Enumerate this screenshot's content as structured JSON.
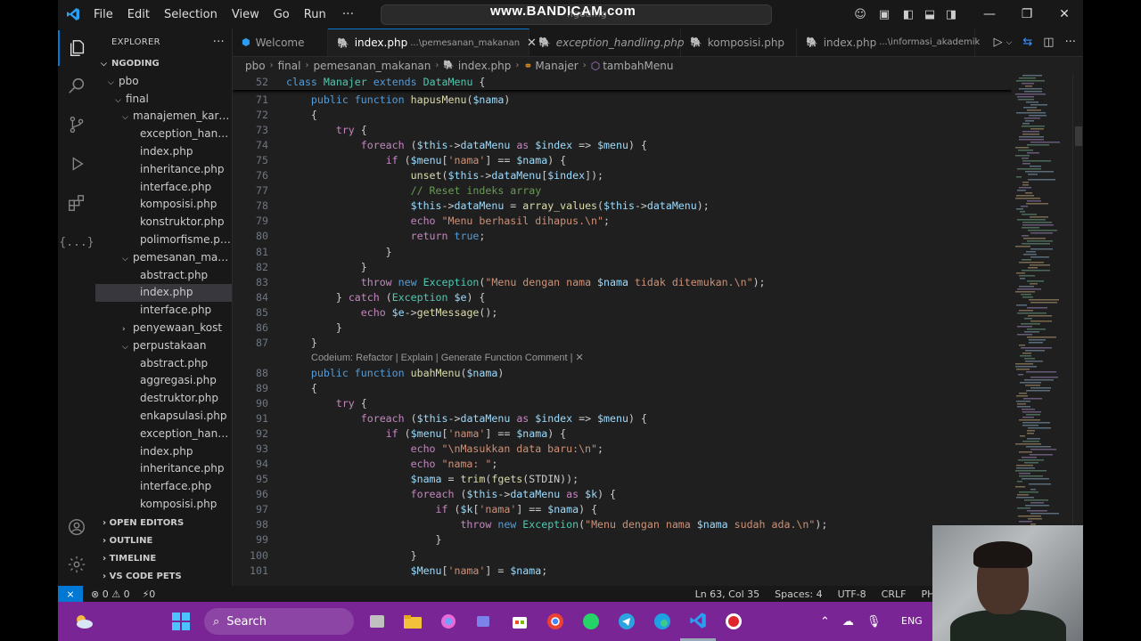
{
  "titlebar": {
    "menu": [
      "File",
      "Edit",
      "Selection",
      "View",
      "Go",
      "Run"
    ],
    "more": "···",
    "watermark": "www.BANDICAM.com",
    "search_text": "ngoding"
  },
  "sidebar": {
    "title": "EXPLORER",
    "more": "···",
    "tree": [
      {
        "label": "NGODING",
        "depth": 0,
        "chev": "⌵",
        "bold": true
      },
      {
        "label": "pbo",
        "depth": 1,
        "chev": "⌵"
      },
      {
        "label": "final",
        "depth": 2,
        "chev": "⌵"
      },
      {
        "label": "manajemen_karya...",
        "depth": 3,
        "chev": "⌵"
      },
      {
        "label": "exception_handli...",
        "depth": 4,
        "chev": ""
      },
      {
        "label": "index.php",
        "depth": 4,
        "chev": ""
      },
      {
        "label": "inheritance.php",
        "depth": 4,
        "chev": ""
      },
      {
        "label": "interface.php",
        "depth": 4,
        "chev": ""
      },
      {
        "label": "komposisi.php",
        "depth": 4,
        "chev": ""
      },
      {
        "label": "konstruktor.php",
        "depth": 4,
        "chev": ""
      },
      {
        "label": "polimorfisme.php",
        "depth": 4,
        "chev": ""
      },
      {
        "label": "pemesanan_maka...",
        "depth": 3,
        "chev": "⌵"
      },
      {
        "label": "abstract.php",
        "depth": 4,
        "chev": ""
      },
      {
        "label": "index.php",
        "depth": 4,
        "chev": "",
        "selected": true
      },
      {
        "label": "interface.php",
        "depth": 4,
        "chev": ""
      },
      {
        "label": "penyewaan_kost",
        "depth": 3,
        "chev": "›"
      },
      {
        "label": "perpustakaan",
        "depth": 3,
        "chev": "⌵"
      },
      {
        "label": "abstract.php",
        "depth": 4,
        "chev": ""
      },
      {
        "label": "aggregasi.php",
        "depth": 4,
        "chev": ""
      },
      {
        "label": "destruktor.php",
        "depth": 4,
        "chev": ""
      },
      {
        "label": "enkapsulasi.php",
        "depth": 4,
        "chev": ""
      },
      {
        "label": "exception_handli...",
        "depth": 4,
        "chev": ""
      },
      {
        "label": "index.php",
        "depth": 4,
        "chev": ""
      },
      {
        "label": "inheritance.php",
        "depth": 4,
        "chev": ""
      },
      {
        "label": "interface.php",
        "depth": 4,
        "chev": ""
      },
      {
        "label": "komposisi.php",
        "depth": 4,
        "chev": ""
      }
    ],
    "sections": [
      "OPEN EDITORS",
      "OUTLINE",
      "TIMELINE",
      "VS CODE PETS"
    ]
  },
  "tabs": [
    {
      "label": "Welcome",
      "desc": "",
      "icon": "vscode-icon",
      "active": false,
      "italic": false
    },
    {
      "label": "index.php",
      "desc": "...\\pemesanan_makanan",
      "icon": "php-icon",
      "active": true,
      "italic": false
    },
    {
      "label": "exception_handling.php",
      "desc": "",
      "icon": "php-icon",
      "active": false,
      "italic": true
    },
    {
      "label": "komposisi.php",
      "desc": "",
      "icon": "php-icon",
      "active": false,
      "italic": false
    },
    {
      "label": "index.php",
      "desc": "...\\informasi_akademik",
      "icon": "php-icon",
      "active": false,
      "italic": false
    }
  ],
  "breadcrumb": [
    "pbo",
    "final",
    "pemesanan_makanan",
    "index.php",
    "Manajer",
    "tambahMenu"
  ],
  "editor": {
    "sticky": {
      "ln": "52",
      "html": "<span class='kw'>class</span> <span class='cls'>Manajer</span> <span class='kw'>extends</span> <span class='cls'>DataMenu</span> {"
    },
    "lens": "Codeium: Refactor | Explain | Generate Function Comment | ✕",
    "lines": [
      {
        "ln": "71",
        "html": "    <span class='kw'>public</span> <span class='kw'>function</span> <span class='fn'>hapusMenu</span>(<span class='var'>$nama</span>)"
      },
      {
        "ln": "72",
        "html": "    {"
      },
      {
        "ln": "73",
        "html": "        <span class='kw2'>try</span> {"
      },
      {
        "ln": "74",
        "html": "            <span class='kw2'>foreach</span> (<span class='var'>$this</span>-><span class='var'>dataMenu</span> <span class='kw2'>as</span> <span class='var'>$index</span> => <span class='var'>$menu</span>) {"
      },
      {
        "ln": "75",
        "html": "                <span class='kw2'>if</span> (<span class='var'>$menu</span>[<span class='str'>'nama'</span>] == <span class='var'>$nama</span>) {"
      },
      {
        "ln": "76",
        "html": "                    <span class='fn'>unset</span>(<span class='var'>$this</span>-><span class='var'>dataMenu</span>[<span class='var'>$index</span>]);"
      },
      {
        "ln": "77",
        "html": "                    <span class='cmt'>// Reset indeks array</span>"
      },
      {
        "ln": "78",
        "html": "                    <span class='var'>$this</span>-><span class='var'>dataMenu</span> = <span class='fn'>array_values</span>(<span class='var'>$this</span>-><span class='var'>dataMenu</span>);"
      },
      {
        "ln": "79",
        "html": "                    <span class='kw2'>echo</span> <span class='str'>\"Menu berhasil dihapus.\\n\"</span>;"
      },
      {
        "ln": "80",
        "html": "                    <span class='kw2'>return</span> <span class='kw'>true</span>;"
      },
      {
        "ln": "81",
        "html": "                }"
      },
      {
        "ln": "82",
        "html": "            }"
      },
      {
        "ln": "83",
        "html": "            <span class='kw2'>throw</span> <span class='kw'>new</span> <span class='cls'>Exception</span>(<span class='str'>\"Menu dengan nama </span><span class='var'>$nama</span><span class='str'> tidak ditemukan.\\n\"</span>);"
      },
      {
        "ln": "84",
        "html": "        } <span class='kw2'>catch</span> (<span class='cls'>Exception</span> <span class='var'>$e</span>) {"
      },
      {
        "ln": "85",
        "html": "            <span class='kw2'>echo</span> <span class='var'>$e</span>-><span class='fn'>getMessage</span>();"
      },
      {
        "ln": "86",
        "html": "        }"
      },
      {
        "ln": "87",
        "html": "    }"
      },
      {
        "ln": "",
        "html": "",
        "lens": true
      },
      {
        "ln": "88",
        "html": "    <span class='kw'>public</span> <span class='kw'>function</span> <span class='fn'>ubahMenu</span>(<span class='var'>$nama</span>)"
      },
      {
        "ln": "89",
        "html": "    {"
      },
      {
        "ln": "90",
        "html": "        <span class='kw2'>try</span> {"
      },
      {
        "ln": "91",
        "html": "            <span class='kw2'>foreach</span> (<span class='var'>$this</span>-><span class='var'>dataMenu</span> <span class='kw2'>as</span> <span class='var'>$index</span> => <span class='var'>$menu</span>) {"
      },
      {
        "ln": "92",
        "html": "                <span class='kw2'>if</span> (<span class='var'>$menu</span>[<span class='str'>'nama'</span>] == <span class='var'>$nama</span>) {"
      },
      {
        "ln": "93",
        "html": "                    <span class='kw2'>echo</span> <span class='str'>\"\\nMasukkan data baru:\\n\"</span>;"
      },
      {
        "ln": "94",
        "html": "                    <span class='kw2'>echo</span> <span class='str'>\"nama: \"</span>;"
      },
      {
        "ln": "95",
        "html": "                    <span class='var'>$nama</span> = <span class='fn'>trim</span>(<span class='fn'>fgets</span>(STDIN));"
      },
      {
        "ln": "96",
        "html": "                    <span class='kw2'>foreach</span> (<span class='var'>$this</span>-><span class='var'>dataMenu</span> <span class='kw2'>as</span> <span class='var'>$k</span>) {"
      },
      {
        "ln": "97",
        "html": "                        <span class='kw2'>if</span> (<span class='var'>$k</span>[<span class='str'>'nama'</span>] == <span class='var'>$nama</span>) {"
      },
      {
        "ln": "98",
        "html": "                            <span class='kw2'>throw</span> <span class='kw'>new</span> <span class='cls'>Exception</span>(<span class='str'>\"Menu dengan nama </span><span class='var'>$nama</span><span class='str'> sudah ada.\\n\"</span>);"
      },
      {
        "ln": "99",
        "html": "                        }"
      },
      {
        "ln": "100",
        "html": "                    }"
      },
      {
        "ln": "101",
        "html": "                    <span class='var'>$Menu</span>[<span class='str'>'nama'</span>] = <span class='var'>$nama</span>;"
      }
    ]
  },
  "statusbar": {
    "errors": "⊗ 0 ⚠ 0",
    "ports": "⚡0",
    "position": "Ln 63, Col 35",
    "spaces": "Spaces: 4",
    "encoding": "UTF-8",
    "eol": "CRLF",
    "language": "PHP"
  },
  "taskbar": {
    "search_label": "Search",
    "lang": "ENG"
  },
  "colors": {
    "accent": "#0078d4",
    "taskbar": "#7a2596"
  }
}
